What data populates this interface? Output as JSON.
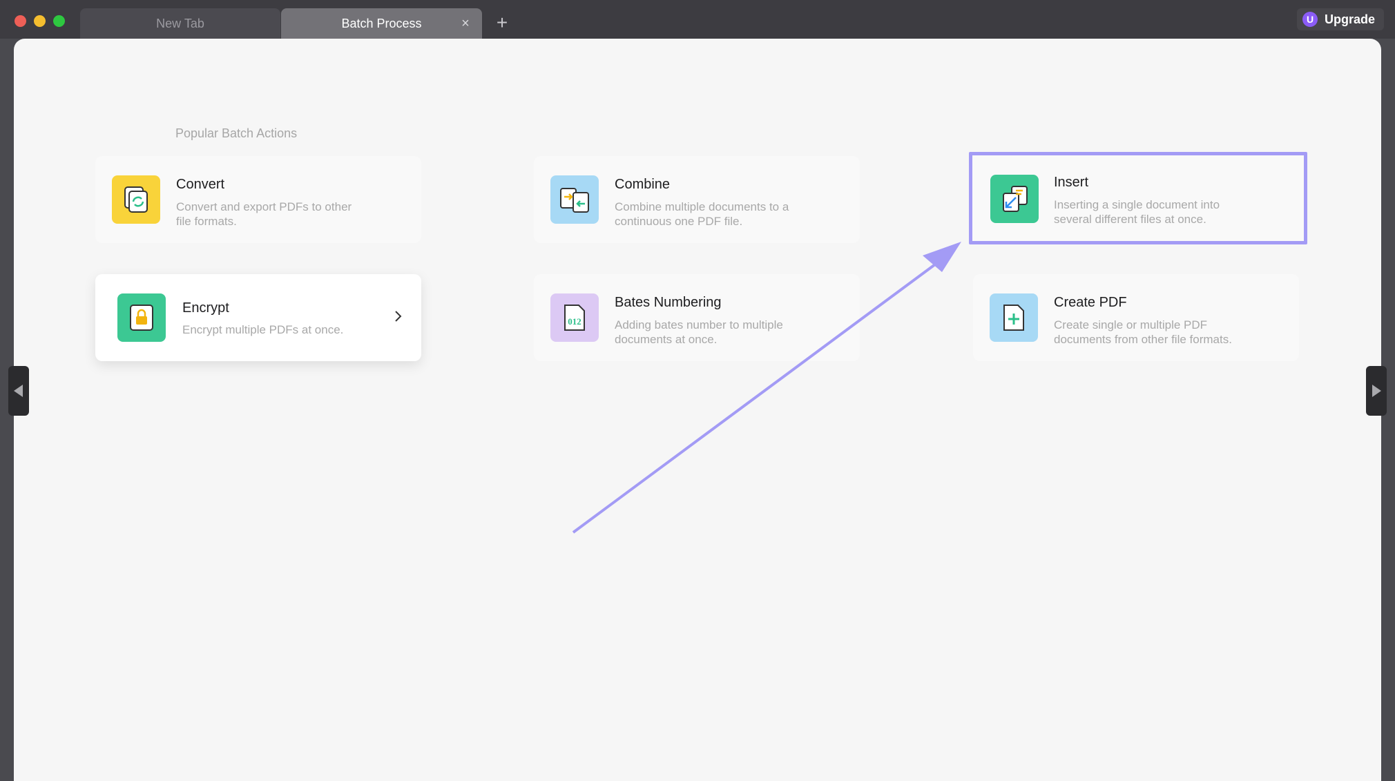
{
  "tabs": [
    {
      "label": "New Tab"
    },
    {
      "label": "Batch Process",
      "active": true
    }
  ],
  "tab_add_label": "+",
  "tab_close_label": "×",
  "upgrade": {
    "icon_letter": "U",
    "label": "Upgrade"
  },
  "section_title": "Popular Batch Actions",
  "cards": [
    {
      "title": "Convert",
      "desc_line1": "Convert and export PDFs to other",
      "desc_line2": "file formats.",
      "icon": "convert-icon",
      "icon_color": "#f9d33a"
    },
    {
      "title": "Combine",
      "desc_line1": "Combine multiple documents to a",
      "desc_line2": "continuous one PDF file.",
      "icon": "combine-icon",
      "icon_color": "#a7d9f5"
    },
    {
      "title": "Insert",
      "desc_line1": "Inserting a single document into",
      "desc_line2": "several different files at once.",
      "icon": "insert-icon",
      "icon_color": "#3cc893"
    },
    {
      "title": "Encrypt",
      "desc_line1": "Encrypt multiple PDFs at once.",
      "desc_line2": "",
      "icon": "lock-icon",
      "icon_color": "#3cc893"
    },
    {
      "title": "Bates Numbering",
      "desc_line1": "Adding bates number to multiple",
      "desc_line2": "documents at once.",
      "icon": "bates-numbering-icon",
      "icon_color": "#dcc9f4",
      "icon_text": "012"
    },
    {
      "title": "Create PDF",
      "desc_line1": "Create single or multiple PDF",
      "desc_line2": "documents from other file formats.",
      "icon": "create-pdf-icon",
      "icon_color": "#a7d9f5"
    }
  ],
  "highlight_color": "#a39bf5",
  "arrow_color": "#a39bf5"
}
